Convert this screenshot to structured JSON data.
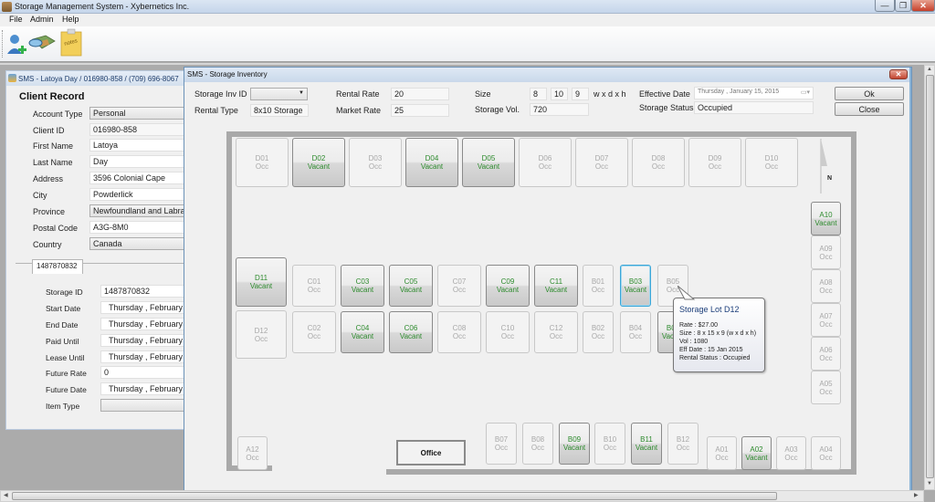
{
  "window": {
    "title": "Storage Management System - Xybernetics Inc.",
    "controls": {
      "minimize": "—",
      "restore": "❐",
      "close": "✕"
    }
  },
  "menu": [
    "File",
    "Admin",
    "Help"
  ],
  "toolbar": {
    "tools": [
      {
        "name": "add-client",
        "icon": "add-user-icon"
      },
      {
        "name": "storage-map",
        "icon": "map-icon"
      },
      {
        "name": "notes",
        "icon": "notes-icon",
        "label": "notes"
      }
    ]
  },
  "client_panel": {
    "header": "SMS - Latoya Day  /  016980-858  /  (709) 696-8067",
    "title": "Client Record",
    "fields": [
      {
        "label": "Account Type",
        "value": "Personal",
        "kind": "combo"
      },
      {
        "label": "Client ID",
        "value": "016980-858",
        "kind": "readonly"
      },
      {
        "label": "First Name",
        "value": "Latoya",
        "kind": "text"
      },
      {
        "label": "Last Name",
        "value": "Day",
        "kind": "text"
      },
      {
        "label": "Address",
        "value": "3596 Colonial Cape",
        "kind": "text"
      },
      {
        "label": "City",
        "value": "Powderlick",
        "kind": "text"
      },
      {
        "label": "Province",
        "value": "Newfoundland and Labrador",
        "kind": "combo"
      },
      {
        "label": "Postal Code",
        "value": "A3G-8M0",
        "kind": "text"
      },
      {
        "label": "Country",
        "value": "Canada",
        "kind": "combo"
      }
    ],
    "tab": "1487870832",
    "storage_fields": [
      {
        "label": "Storage ID",
        "value": "1487870832"
      },
      {
        "label": "Start Date",
        "value": "Thursday  ,  February"
      },
      {
        "label": "End Date",
        "value": "Thursday  ,  February"
      },
      {
        "label": "Paid Until",
        "value": "Thursday  ,  February"
      },
      {
        "label": "Lease Until",
        "value": "Thursday  ,  February"
      },
      {
        "label": "Future Rate",
        "value": "0"
      },
      {
        "label": "Future Date",
        "value": "Thursday  ,  February"
      },
      {
        "label": "Item Type",
        "value": ""
      }
    ]
  },
  "inventory": {
    "title": "SMS - Storage Inventory",
    "close": "✕",
    "storage_inv_id_label": "Storage Inv ID",
    "storage_inv_id_value": "",
    "rental_type_label": "Rental Type",
    "rental_type_value": "8x10 Storage",
    "rental_rate_label": "Rental Rate",
    "rental_rate_value": "20",
    "market_rate_label": "Market Rate",
    "market_rate_value": "25",
    "size_label": "Size",
    "size_w": "8",
    "size_d": "10",
    "size_h": "9",
    "size_unit": "w x d x h",
    "storage_vol_label": "Storage Vol.",
    "storage_vol_value": "720",
    "effective_date_label": "Effective Date",
    "effective_date_value": "Thursday  ,  January  15, 2015",
    "storage_status_label": "Storage Status",
    "storage_status_value": "Occupied",
    "ok_label": "Ok",
    "close_label": "Close",
    "compass": "N",
    "office_label": "Office",
    "lots": {
      "D01": "Occ",
      "D02": "Vacant",
      "D03": "Occ",
      "D04": "Vacant",
      "D05": "Vacant",
      "D06": "Occ",
      "D07": "Occ",
      "D08": "Occ",
      "D09": "Occ",
      "D10": "Occ",
      "D11": "Vacant",
      "D12": "Occ",
      "C01": "Occ",
      "C02": "Occ",
      "C03": "Vacant",
      "C04": "Vacant",
      "C05": "Vacant",
      "C06": "Vacant",
      "C07": "Occ",
      "C08": "Occ",
      "C09": "Vacant",
      "C10": "Occ",
      "C11": "Vacant",
      "C12": "Occ",
      "B01": "Occ",
      "B02": "Occ",
      "B03": "Vacant",
      "B04": "Occ",
      "B05": "Occ",
      "B06": "Vacant",
      "B07": "Occ",
      "B08": "Occ",
      "B09": "Vacant",
      "B10": "Occ",
      "B11": "Vacant",
      "B12": "Occ",
      "A01": "Occ",
      "A02": "Vacant",
      "A03": "Occ",
      "A04": "Occ",
      "A05": "Occ",
      "A06": "Occ",
      "A07": "Occ",
      "A08": "Occ",
      "A09": "Occ",
      "A10": "Vacant",
      "A12": "Occ"
    },
    "selected_lot": "B03",
    "tooltip": {
      "title": "Storage Lot D12",
      "lines": [
        "Rate : $27.00",
        "Size : 8 x 15 x 9 (w x d x h)",
        "Vol : 1080",
        "Eff Date : 15 Jan 2015",
        "Rental Status : Occupied"
      ]
    }
  },
  "colors": {
    "vacant_text": "#2e8b2e",
    "occ_text": "#a8a8a8",
    "selected_border": "#3aa6d8",
    "close_red": "#c6402b"
  }
}
